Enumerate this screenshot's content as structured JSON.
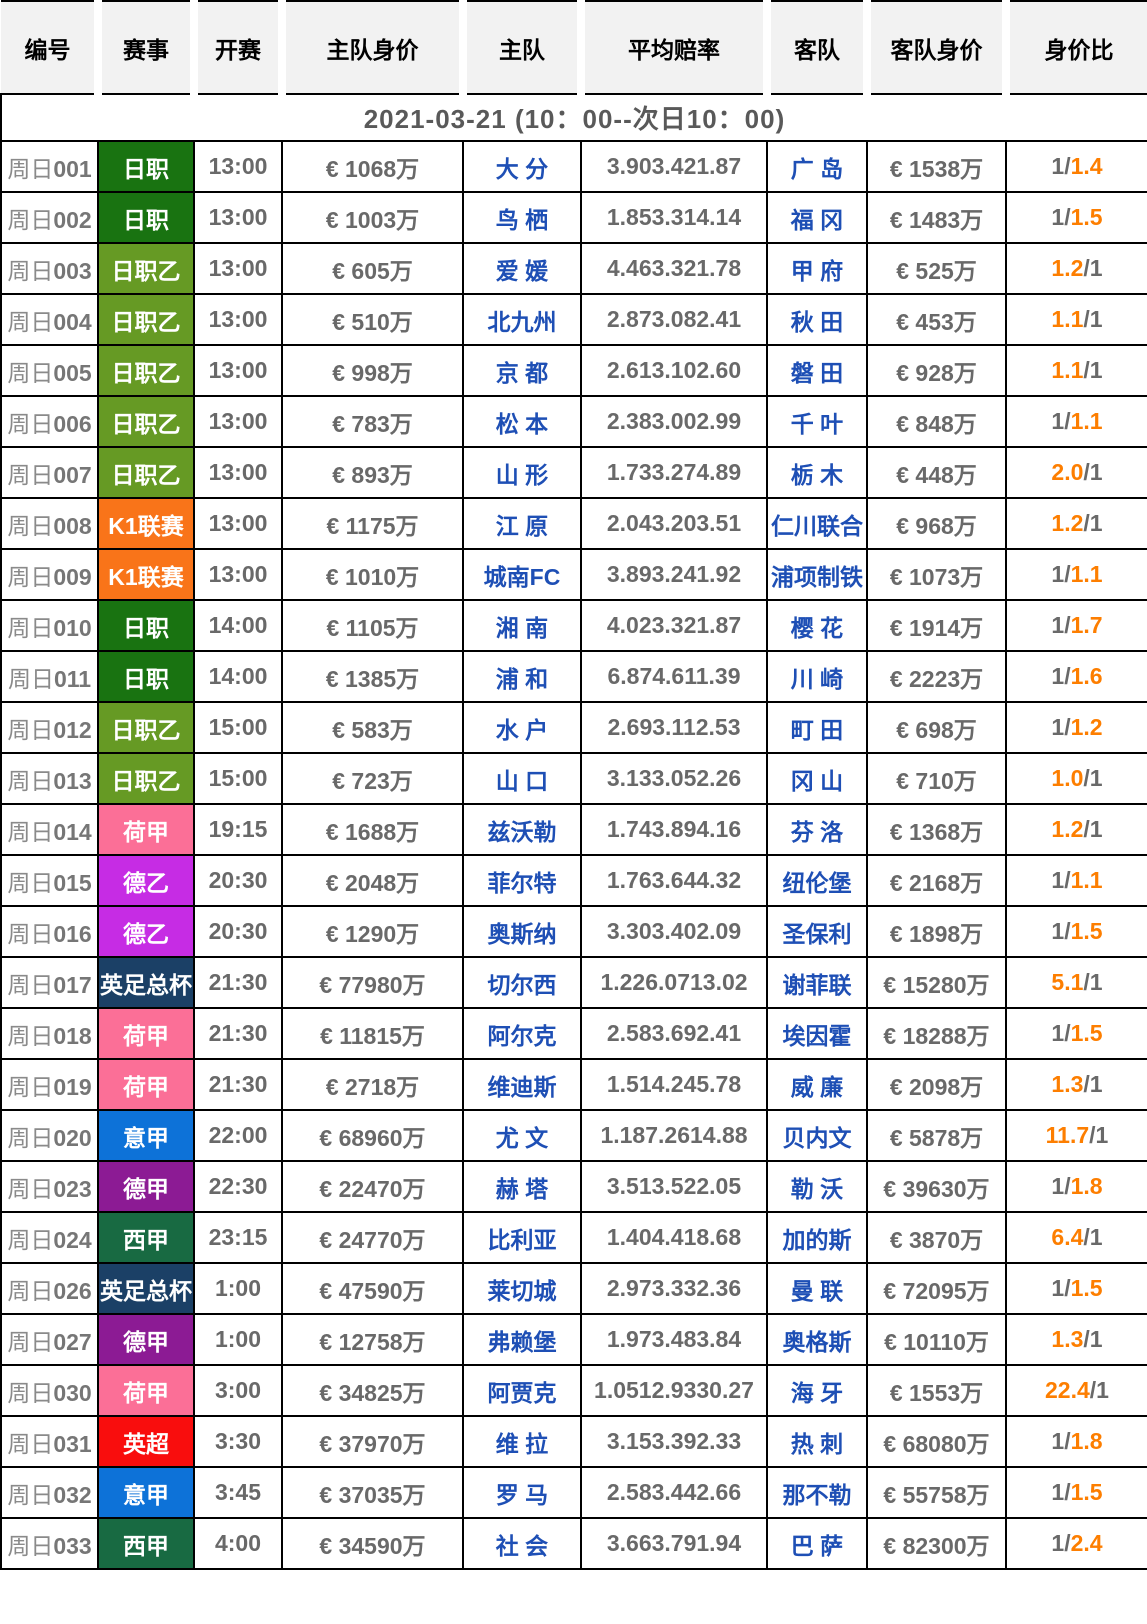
{
  "header": {
    "columns": [
      "编号",
      "赛事",
      "开赛",
      "主队身价",
      "主队",
      "平均赔率",
      "客队",
      "客队身价",
      "身价比"
    ]
  },
  "date_banner": "2021-03-21 (10：00--次日10：00)",
  "league_colors": {
    "日职": "#197311",
    "日职乙": "#669a24",
    "K1联赛": "#f97419",
    "荷甲": "#fb6f97",
    "德乙": "#c62ce4",
    "英足总杯": "#1b4066",
    "意甲": "#0d72d8",
    "德甲": "#8c1b94",
    "西甲": "#186a42",
    "英超": "#f90d0d"
  },
  "accent_color": "#fd7e00",
  "team_color": "#1e4fb5",
  "rows": [
    {
      "prefix": "周日",
      "code": "001",
      "league": "日职",
      "time": "13:00",
      "home_value": "€ 1068万",
      "home": "大 分",
      "odds": "3.903.421.87",
      "away": "广 岛",
      "away_value": "€ 1538万",
      "ratio": {
        "pre": "1/",
        "accent": "1.4",
        "post": ""
      }
    },
    {
      "prefix": "周日",
      "code": "002",
      "league": "日职",
      "time": "13:00",
      "home_value": "€ 1003万",
      "home": "鸟 栖",
      "odds": "1.853.314.14",
      "away": "福 冈",
      "away_value": "€ 1483万",
      "ratio": {
        "pre": "1/",
        "accent": "1.5",
        "post": ""
      }
    },
    {
      "prefix": "周日",
      "code": "003",
      "league": "日职乙",
      "time": "13:00",
      "home_value": "€ 605万",
      "home": "爱 媛",
      "odds": "4.463.321.78",
      "away": "甲 府",
      "away_value": "€ 525万",
      "ratio": {
        "pre": "",
        "accent": "1.2",
        "post": "/1"
      }
    },
    {
      "prefix": "周日",
      "code": "004",
      "league": "日职乙",
      "time": "13:00",
      "home_value": "€ 510万",
      "home": "北九州",
      "odds": "2.873.082.41",
      "away": "秋 田",
      "away_value": "€ 453万",
      "ratio": {
        "pre": "",
        "accent": "1.1",
        "post": "/1"
      }
    },
    {
      "prefix": "周日",
      "code": "005",
      "league": "日职乙",
      "time": "13:00",
      "home_value": "€ 998万",
      "home": "京 都",
      "odds": "2.613.102.60",
      "away": "磐 田",
      "away_value": "€ 928万",
      "ratio": {
        "pre": "",
        "accent": "1.1",
        "post": "/1"
      }
    },
    {
      "prefix": "周日",
      "code": "006",
      "league": "日职乙",
      "time": "13:00",
      "home_value": "€ 783万",
      "home": "松 本",
      "odds": "2.383.002.99",
      "away": "千 叶",
      "away_value": "€ 848万",
      "ratio": {
        "pre": "1/",
        "accent": "1.1",
        "post": ""
      }
    },
    {
      "prefix": "周日",
      "code": "007",
      "league": "日职乙",
      "time": "13:00",
      "home_value": "€ 893万",
      "home": "山 形",
      "odds": "1.733.274.89",
      "away": "栃 木",
      "away_value": "€ 448万",
      "ratio": {
        "pre": "",
        "accent": "2.0",
        "post": "/1"
      }
    },
    {
      "prefix": "周日",
      "code": "008",
      "league": "K1联赛",
      "time": "13:00",
      "home_value": "€ 1175万",
      "home": "江 原",
      "odds": "2.043.203.51",
      "away": "仁川联合",
      "away_value": "€ 968万",
      "ratio": {
        "pre": "",
        "accent": "1.2",
        "post": "/1"
      }
    },
    {
      "prefix": "周日",
      "code": "009",
      "league": "K1联赛",
      "time": "13:00",
      "home_value": "€ 1010万",
      "home": "城南FC",
      "odds": "3.893.241.92",
      "away": "浦项制铁",
      "away_value": "€ 1073万",
      "ratio": {
        "pre": "1/",
        "accent": "1.1",
        "post": ""
      }
    },
    {
      "prefix": "周日",
      "code": "010",
      "league": "日职",
      "time": "14:00",
      "home_value": "€ 1105万",
      "home": "湘 南",
      "odds": "4.023.321.87",
      "away": "樱 花",
      "away_value": "€ 1914万",
      "ratio": {
        "pre": "1/",
        "accent": "1.7",
        "post": ""
      }
    },
    {
      "prefix": "周日",
      "code": "011",
      "league": "日职",
      "time": "14:00",
      "home_value": "€ 1385万",
      "home": "浦 和",
      "odds": "6.874.611.39",
      "away": "川 崎",
      "away_value": "€ 2223万",
      "ratio": {
        "pre": "1/",
        "accent": "1.6",
        "post": ""
      }
    },
    {
      "prefix": "周日",
      "code": "012",
      "league": "日职乙",
      "time": "15:00",
      "home_value": "€ 583万",
      "home": "水 户",
      "odds": "2.693.112.53",
      "away": "町 田",
      "away_value": "€ 698万",
      "ratio": {
        "pre": "1/",
        "accent": "1.2",
        "post": ""
      }
    },
    {
      "prefix": "周日",
      "code": "013",
      "league": "日职乙",
      "time": "15:00",
      "home_value": "€ 723万",
      "home": "山 口",
      "odds": "3.133.052.26",
      "away": "冈 山",
      "away_value": "€ 710万",
      "ratio": {
        "pre": "",
        "accent": "1.0",
        "post": "/1"
      }
    },
    {
      "prefix": "周日",
      "code": "014",
      "league": "荷甲",
      "time": "19:15",
      "home_value": "€ 1688万",
      "home": "兹沃勒",
      "odds": "1.743.894.16",
      "away": "芬 洛",
      "away_value": "€ 1368万",
      "ratio": {
        "pre": "",
        "accent": "1.2",
        "post": "/1"
      }
    },
    {
      "prefix": "周日",
      "code": "015",
      "league": "德乙",
      "time": "20:30",
      "home_value": "€ 2048万",
      "home": "菲尔特",
      "odds": "1.763.644.32",
      "away": "纽伦堡",
      "away_value": "€ 2168万",
      "ratio": {
        "pre": "1/",
        "accent": "1.1",
        "post": ""
      }
    },
    {
      "prefix": "周日",
      "code": "016",
      "league": "德乙",
      "time": "20:30",
      "home_value": "€ 1290万",
      "home": "奥斯纳",
      "odds": "3.303.402.09",
      "away": "圣保利",
      "away_value": "€ 1898万",
      "ratio": {
        "pre": "1/",
        "accent": "1.5",
        "post": ""
      }
    },
    {
      "prefix": "周日",
      "code": "017",
      "league": "英足总杯",
      "time": "21:30",
      "home_value": "€ 77980万",
      "home": "切尔西",
      "odds": "1.226.0713.02",
      "away": "谢菲联",
      "away_value": "€ 15280万",
      "ratio": {
        "pre": "",
        "accent": "5.1",
        "post": "/1"
      }
    },
    {
      "prefix": "周日",
      "code": "018",
      "league": "荷甲",
      "time": "21:30",
      "home_value": "€ 11815万",
      "home": "阿尔克",
      "odds": "2.583.692.41",
      "away": "埃因霍",
      "away_value": "€ 18288万",
      "ratio": {
        "pre": "1/",
        "accent": "1.5",
        "post": ""
      }
    },
    {
      "prefix": "周日",
      "code": "019",
      "league": "荷甲",
      "time": "21:30",
      "home_value": "€ 2718万",
      "home": "维迪斯",
      "odds": "1.514.245.78",
      "away": "威 廉",
      "away_value": "€ 2098万",
      "ratio": {
        "pre": "",
        "accent": "1.3",
        "post": "/1"
      }
    },
    {
      "prefix": "周日",
      "code": "020",
      "league": "意甲",
      "time": "22:00",
      "home_value": "€ 68960万",
      "home": "尤 文",
      "odds": "1.187.2614.88",
      "away": "贝内文",
      "away_value": "€ 5878万",
      "ratio": {
        "pre": "",
        "accent": "11.7",
        "post": "/1"
      }
    },
    {
      "prefix": "周日",
      "code": "023",
      "league": "德甲",
      "time": "22:30",
      "home_value": "€ 22470万",
      "home": "赫 塔",
      "odds": "3.513.522.05",
      "away": "勒 沃",
      "away_value": "€ 39630万",
      "ratio": {
        "pre": "1/",
        "accent": "1.8",
        "post": ""
      }
    },
    {
      "prefix": "周日",
      "code": "024",
      "league": "西甲",
      "time": "23:15",
      "home_value": "€ 24770万",
      "home": "比利亚",
      "odds": "1.404.418.68",
      "away": "加的斯",
      "away_value": "€ 3870万",
      "ratio": {
        "pre": "",
        "accent": "6.4",
        "post": "/1"
      }
    },
    {
      "prefix": "周日",
      "code": "026",
      "league": "英足总杯",
      "time": "1:00",
      "home_value": "€ 47590万",
      "home": "莱切城",
      "odds": "2.973.332.36",
      "away": "曼 联",
      "away_value": "€ 72095万",
      "ratio": {
        "pre": "1/",
        "accent": "1.5",
        "post": ""
      }
    },
    {
      "prefix": "周日",
      "code": "027",
      "league": "德甲",
      "time": "1:00",
      "home_value": "€ 12758万",
      "home": "弗赖堡",
      "odds": "1.973.483.84",
      "away": "奥格斯",
      "away_value": "€ 10110万",
      "ratio": {
        "pre": "",
        "accent": "1.3",
        "post": "/1"
      }
    },
    {
      "prefix": "周日",
      "code": "030",
      "league": "荷甲",
      "time": "3:00",
      "home_value": "€ 34825万",
      "home": "阿贾克",
      "odds": "1.0512.9330.27",
      "away": "海 牙",
      "away_value": "€ 1553万",
      "ratio": {
        "pre": "",
        "accent": "22.4",
        "post": "/1"
      }
    },
    {
      "prefix": "周日",
      "code": "031",
      "league": "英超",
      "time": "3:30",
      "home_value": "€ 37970万",
      "home": "维 拉",
      "odds": "3.153.392.33",
      "away": "热 刺",
      "away_value": "€ 68080万",
      "ratio": {
        "pre": "1/",
        "accent": "1.8",
        "post": ""
      }
    },
    {
      "prefix": "周日",
      "code": "032",
      "league": "意甲",
      "time": "3:45",
      "home_value": "€ 37035万",
      "home": "罗 马",
      "odds": "2.583.442.66",
      "away": "那不勒",
      "away_value": "€ 55758万",
      "ratio": {
        "pre": "1/",
        "accent": "1.5",
        "post": ""
      }
    },
    {
      "prefix": "周日",
      "code": "033",
      "league": "西甲",
      "time": "4:00",
      "home_value": "€ 34590万",
      "home": "社 会",
      "odds": "3.663.791.94",
      "away": "巴 萨",
      "away_value": "€ 82300万",
      "ratio": {
        "pre": "1/",
        "accent": "2.4",
        "post": ""
      }
    }
  ]
}
